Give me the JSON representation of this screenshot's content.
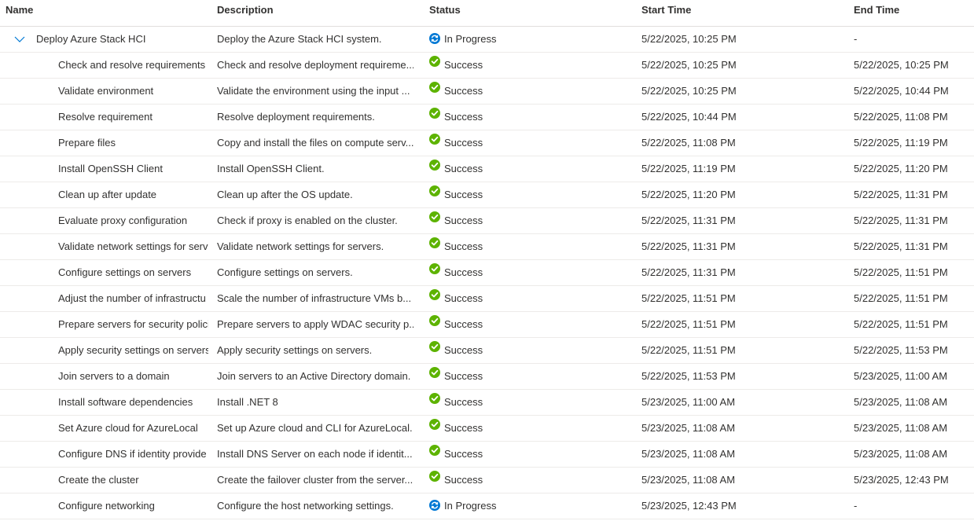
{
  "columns": {
    "name": "Name",
    "description": "Description",
    "status": "Status",
    "start": "Start Time",
    "end": "End Time"
  },
  "colors": {
    "success": "#5db300",
    "in_progress": "#0078d4",
    "chevron": "#0078d4"
  },
  "rows": [
    {
      "name": "Deploy Azure Stack HCI",
      "description": "Deploy the Azure Stack HCI system.",
      "status": "In Progress",
      "status_icon": "in-progress-icon",
      "start": "5/22/2025, 10:25 PM",
      "end": "-"
    },
    {
      "name": "Check and resolve requirements",
      "description": "Check and resolve deployment requireme...",
      "status": "Success",
      "status_icon": "success-check-icon",
      "start": "5/22/2025, 10:25 PM",
      "end": "5/22/2025, 10:25 PM"
    },
    {
      "name": "Validate environment",
      "description": "Validate the environment using the input ...",
      "status": "Success",
      "status_icon": "success-check-icon",
      "start": "5/22/2025, 10:25 PM",
      "end": "5/22/2025, 10:44 PM"
    },
    {
      "name": "Resolve requirement",
      "description": "Resolve deployment requirements.",
      "status": "Success",
      "status_icon": "success-check-icon",
      "start": "5/22/2025, 10:44 PM",
      "end": "5/22/2025, 11:08 PM"
    },
    {
      "name": "Prepare files",
      "description": "Copy and install the files on compute serv...",
      "status": "Success",
      "status_icon": "success-check-icon",
      "start": "5/22/2025, 11:08 PM",
      "end": "5/22/2025, 11:19 PM"
    },
    {
      "name": "Install OpenSSH Client",
      "description": "Install OpenSSH Client.",
      "status": "Success",
      "status_icon": "success-check-icon",
      "start": "5/22/2025, 11:19 PM",
      "end": "5/22/2025, 11:20 PM"
    },
    {
      "name": "Clean up after update",
      "description": "Clean up after the OS update.",
      "status": "Success",
      "status_icon": "success-check-icon",
      "start": "5/22/2025, 11:20 PM",
      "end": "5/22/2025, 11:31 PM"
    },
    {
      "name": "Evaluate proxy configuration",
      "description": "Check if proxy is enabled on the cluster.",
      "status": "Success",
      "status_icon": "success-check-icon",
      "start": "5/22/2025, 11:31 PM",
      "end": "5/22/2025, 11:31 PM"
    },
    {
      "name": "Validate network settings for serv",
      "description": "Validate network settings for servers.",
      "status": "Success",
      "status_icon": "success-check-icon",
      "start": "5/22/2025, 11:31 PM",
      "end": "5/22/2025, 11:31 PM"
    },
    {
      "name": "Configure settings on servers",
      "description": "Configure settings on servers.",
      "status": "Success",
      "status_icon": "success-check-icon",
      "start": "5/22/2025, 11:31 PM",
      "end": "5/22/2025, 11:51 PM"
    },
    {
      "name": "Adjust the number of infrastructu",
      "description": "Scale the number of infrastructure VMs b...",
      "status": "Success",
      "status_icon": "success-check-icon",
      "start": "5/22/2025, 11:51 PM",
      "end": "5/22/2025, 11:51 PM"
    },
    {
      "name": "Prepare servers for security polici",
      "description": "Prepare servers to apply WDAC security p...",
      "status": "Success",
      "status_icon": "success-check-icon",
      "start": "5/22/2025, 11:51 PM",
      "end": "5/22/2025, 11:51 PM"
    },
    {
      "name": "Apply security settings on servers",
      "description": "Apply security settings on servers.",
      "status": "Success",
      "status_icon": "success-check-icon",
      "start": "5/22/2025, 11:51 PM",
      "end": "5/22/2025, 11:53 PM"
    },
    {
      "name": "Join servers to a domain",
      "description": "Join servers to an Active Directory domain.",
      "status": "Success",
      "status_icon": "success-check-icon",
      "start": "5/22/2025, 11:53 PM",
      "end": "5/23/2025, 11:00 AM"
    },
    {
      "name": "Install software dependencies",
      "description": "Install .NET 8",
      "status": "Success",
      "status_icon": "success-check-icon",
      "start": "5/23/2025, 11:00 AM",
      "end": "5/23/2025, 11:08 AM"
    },
    {
      "name": "Set Azure cloud for AzureLocal",
      "description": "Set up Azure cloud and CLI for AzureLocal.",
      "status": "Success",
      "status_icon": "success-check-icon",
      "start": "5/23/2025, 11:08 AM",
      "end": "5/23/2025, 11:08 AM"
    },
    {
      "name": "Configure DNS if identity provide",
      "description": "Install DNS Server on each node if identit...",
      "status": "Success",
      "status_icon": "success-check-icon",
      "start": "5/23/2025, 11:08 AM",
      "end": "5/23/2025, 11:08 AM"
    },
    {
      "name": "Create the cluster",
      "description": "Create the failover cluster from the server...",
      "status": "Success",
      "status_icon": "success-check-icon",
      "start": "5/23/2025, 11:08 AM",
      "end": "5/23/2025, 12:43 PM"
    },
    {
      "name": "Configure networking",
      "description": "Configure the host networking settings.",
      "status": "In Progress",
      "status_icon": "in-progress-icon",
      "start": "5/23/2025, 12:43 PM",
      "end": "-"
    }
  ]
}
